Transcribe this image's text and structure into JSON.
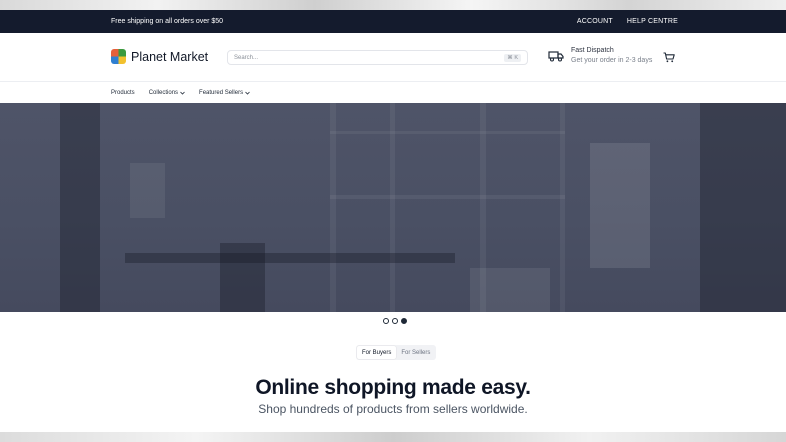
{
  "announcement": {
    "text": "Free shipping on all orders over $50",
    "account_label": "ACCOUNT",
    "help_label": "HELP CENTRE"
  },
  "header": {
    "brand": "Planet Market",
    "search_placeholder": "Search...",
    "search_shortcut": "⌘ K",
    "dispatch_title": "Fast Dispatch",
    "dispatch_subtitle": "Get your order in 2-3 days"
  },
  "nav": {
    "items": [
      {
        "label": "Products"
      },
      {
        "label": "Collections"
      },
      {
        "label": "Featured Sellers"
      }
    ]
  },
  "carousel": {
    "slide_count": 3,
    "active_index": 2
  },
  "audience_toggle": {
    "options": [
      "For Buyers",
      "For Sellers"
    ],
    "selected": "For Buyers"
  },
  "hero_text": {
    "headline": "Online shopping made easy.",
    "subline": "Shop hundreds of products from sellers worldwide."
  },
  "colors": {
    "announce_bg": "#141b2d",
    "hero_overlay": "#4f5468",
    "text_dark": "#0f1626"
  },
  "icons": {
    "logo": "logo-icon",
    "truck": "truck-icon",
    "cart": "cart-icon",
    "chevron": "chevron-down-icon"
  }
}
